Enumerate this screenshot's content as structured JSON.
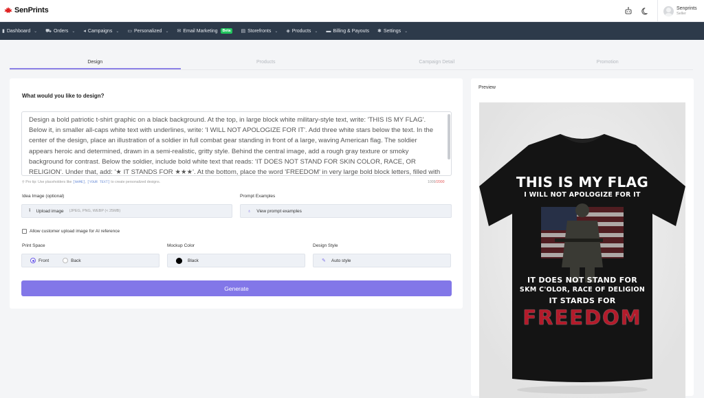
{
  "app": {
    "brand": "SenPrints"
  },
  "user": {
    "name": "Senprints",
    "role": "Seller"
  },
  "nav": [
    {
      "label": "Dashboard",
      "icon": "bar-chart-icon"
    },
    {
      "label": "Orders",
      "icon": "cart-icon"
    },
    {
      "label": "Campaigns",
      "icon": "megaphone-icon"
    },
    {
      "label": "Personalized",
      "icon": "monitor-icon"
    },
    {
      "label": "Email Marketing",
      "icon": "mail-icon",
      "badge": "Beta"
    },
    {
      "label": "Storefronts",
      "icon": "store-icon"
    },
    {
      "label": "Products",
      "icon": "cube-icon"
    },
    {
      "label": "Billing & Payouts",
      "icon": "wallet-icon"
    },
    {
      "label": "Settings",
      "icon": "gear-icon"
    }
  ],
  "tabs": [
    "Design",
    "Products",
    "Campaign Detail",
    "Promotion"
  ],
  "design": {
    "heading": "What would you like to design?",
    "prompt": "Design a bold patriotic t-shirt graphic on a black background. At the top, in large block white military-style text, write: 'THIS IS MY FLAG'. Below it, in smaller all-caps white text with underlines, write: 'I WILL NOT APOLOGIZE FOR IT'. Add three white stars below the text. In the center of the design, place an illustration of a soldier in full combat gear standing in front of a large, waving American flag. The soldier appears heroic and determined, drawn in a semi-realistic, gritty style. Behind the central image, add a rough gray texture or smoky background for contrast. Below the soldier, include bold white text that reads: 'IT DOES NOT STAND FOR SKIN COLOR, RACE, OR RELIGION'. Under that, add: '★ IT STANDS FOR ★★★'. At the bottom, place the word 'FREEDOM' in very large bold block letters, filled with",
    "tip_before": "Pro tip: Use placeholders like",
    "tip_code1": "[NAME]",
    "tip_mid": ",",
    "tip_code2": "[YOUR TEXT]",
    "tip_after": "to create personalized designs.",
    "count": "1009",
    "count_max": "/2000",
    "idea_label": "Idea Image (optional)",
    "upload_label": "Upload image",
    "upload_hint": "(JPEG, PNG, WEBP (< 25MB)",
    "examples_label": "Prompt Examples",
    "examples_button": "View prompt examples",
    "allow_upload": "Allow customer upload image for AI reference",
    "print_space_label": "Print Space",
    "print_front": "Front",
    "print_back": "Back",
    "print_selected": "Front",
    "mockup_label": "Mockup Color",
    "mockup_color": "Black",
    "style_label": "Design Style",
    "style_value": "Auto style",
    "generate": "Generate"
  },
  "preview": {
    "title": "Preview",
    "tee_lines": [
      "THIS IS MY FLAG",
      "I WILL NOT APOLOGIZE FOR IT",
      "IT DOES NOT STAND FOR",
      "SKM C'OLOR, RACE OF DELIGION",
      "IT STARDS FOR",
      "FREEDOM"
    ]
  },
  "colors": {
    "accent": "#8277e8",
    "nav_bg": "#2d3a4a",
    "beta": "#22c55e",
    "limit": "#e45858"
  }
}
